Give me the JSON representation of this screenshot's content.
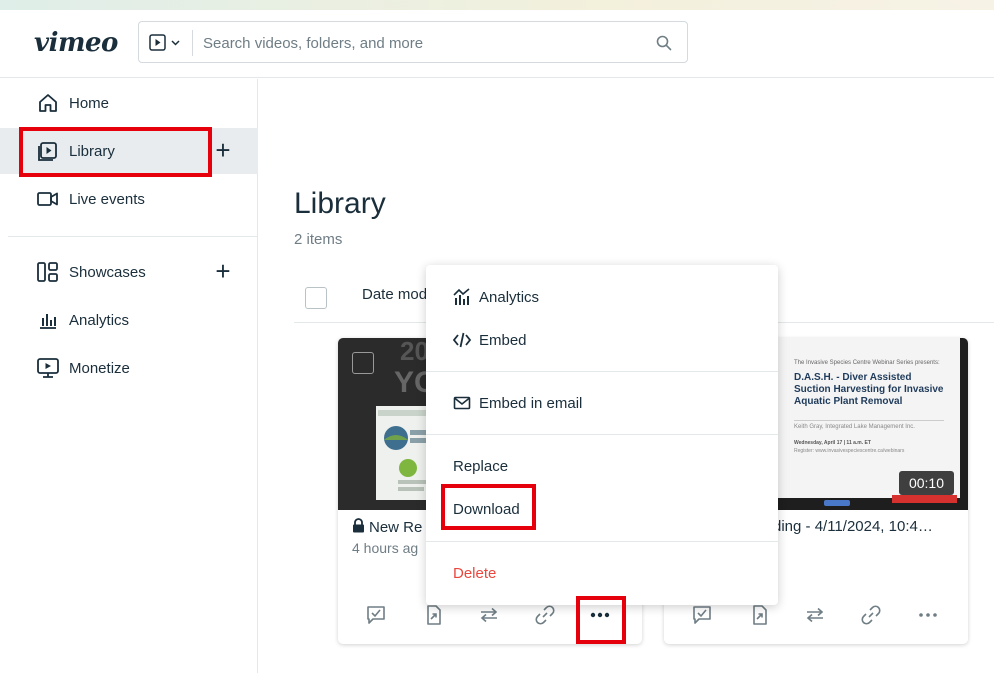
{
  "app": {
    "logo": "vimeo",
    "search_placeholder": "Search videos, folders, and more"
  },
  "sidebar": {
    "items": [
      {
        "label": "Home",
        "icon": "home-icon"
      },
      {
        "label": "Library",
        "icon": "library-icon",
        "active": true
      },
      {
        "label": "Live events",
        "icon": "camera-icon"
      },
      {
        "label": "Showcases",
        "icon": "showcase-icon"
      },
      {
        "label": "Analytics",
        "icon": "analytics-icon"
      },
      {
        "label": "Monetize",
        "icon": "monetize-icon"
      }
    ]
  },
  "main": {
    "title": "Library",
    "count": "2 items",
    "sort_label": "Date mod",
    "cards": [
      {
        "title": "New Re",
        "subtitle": "4 hours ag",
        "locked": true
      },
      {
        "title": "ding - 4/11/2024, 10:4…",
        "duration": "00:10",
        "thumb_header": "The Invasive Species Centre Webinar Series presents:",
        "thumb_title": "D.A.S.H. - Diver Assisted Suction Harvesting for Invasive Aquatic Plant Removal",
        "thumb_author": "Keith Gray, Integrated Lake Management Inc.",
        "thumb_date": "Wednesday, April 17 | 11 a.m. ET",
        "thumb_register": "Register: www.invasivespeciescentre.ca/webinars"
      }
    ]
  },
  "context_menu": {
    "items": [
      {
        "label": "Analytics",
        "icon": "analytics-icon"
      },
      {
        "label": "Embed",
        "icon": "code-icon"
      },
      {
        "label": "Embed in email",
        "icon": "mail-icon"
      },
      {
        "label": "Replace"
      },
      {
        "label": "Download"
      },
      {
        "label": "Delete",
        "danger": true
      }
    ]
  },
  "colors": {
    "highlight": "#e5000b",
    "danger": "#e9473e",
    "active_bg": "#e8ecee",
    "text": "#1a2e3b"
  }
}
